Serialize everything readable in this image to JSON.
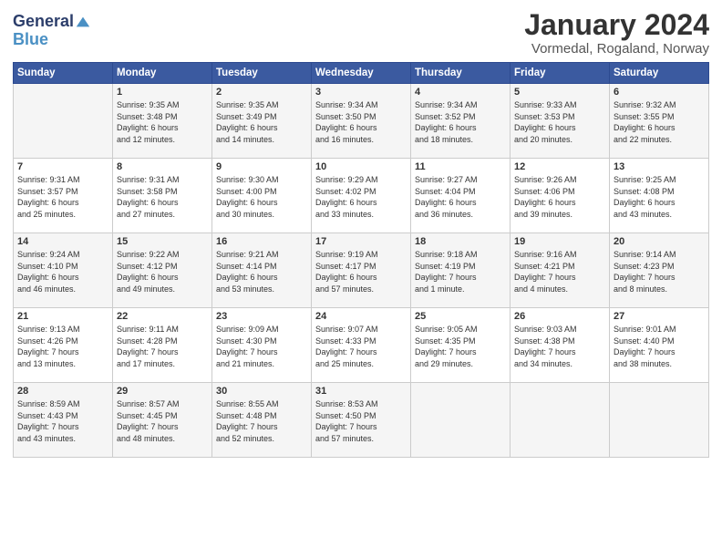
{
  "header": {
    "logo_line1": "General",
    "logo_line2": "Blue",
    "month": "January 2024",
    "location": "Vormedal, Rogaland, Norway"
  },
  "days_of_week": [
    "Sunday",
    "Monday",
    "Tuesday",
    "Wednesday",
    "Thursday",
    "Friday",
    "Saturday"
  ],
  "weeks": [
    [
      {
        "day": "",
        "content": ""
      },
      {
        "day": "1",
        "content": "Sunrise: 9:35 AM\nSunset: 3:48 PM\nDaylight: 6 hours\nand 12 minutes."
      },
      {
        "day": "2",
        "content": "Sunrise: 9:35 AM\nSunset: 3:49 PM\nDaylight: 6 hours\nand 14 minutes."
      },
      {
        "day": "3",
        "content": "Sunrise: 9:34 AM\nSunset: 3:50 PM\nDaylight: 6 hours\nand 16 minutes."
      },
      {
        "day": "4",
        "content": "Sunrise: 9:34 AM\nSunset: 3:52 PM\nDaylight: 6 hours\nand 18 minutes."
      },
      {
        "day": "5",
        "content": "Sunrise: 9:33 AM\nSunset: 3:53 PM\nDaylight: 6 hours\nand 20 minutes."
      },
      {
        "day": "6",
        "content": "Sunrise: 9:32 AM\nSunset: 3:55 PM\nDaylight: 6 hours\nand 22 minutes."
      }
    ],
    [
      {
        "day": "7",
        "content": "Sunrise: 9:31 AM\nSunset: 3:57 PM\nDaylight: 6 hours\nand 25 minutes."
      },
      {
        "day": "8",
        "content": "Sunrise: 9:31 AM\nSunset: 3:58 PM\nDaylight: 6 hours\nand 27 minutes."
      },
      {
        "day": "9",
        "content": "Sunrise: 9:30 AM\nSunset: 4:00 PM\nDaylight: 6 hours\nand 30 minutes."
      },
      {
        "day": "10",
        "content": "Sunrise: 9:29 AM\nSunset: 4:02 PM\nDaylight: 6 hours\nand 33 minutes."
      },
      {
        "day": "11",
        "content": "Sunrise: 9:27 AM\nSunset: 4:04 PM\nDaylight: 6 hours\nand 36 minutes."
      },
      {
        "day": "12",
        "content": "Sunrise: 9:26 AM\nSunset: 4:06 PM\nDaylight: 6 hours\nand 39 minutes."
      },
      {
        "day": "13",
        "content": "Sunrise: 9:25 AM\nSunset: 4:08 PM\nDaylight: 6 hours\nand 43 minutes."
      }
    ],
    [
      {
        "day": "14",
        "content": "Sunrise: 9:24 AM\nSunset: 4:10 PM\nDaylight: 6 hours\nand 46 minutes."
      },
      {
        "day": "15",
        "content": "Sunrise: 9:22 AM\nSunset: 4:12 PM\nDaylight: 6 hours\nand 49 minutes."
      },
      {
        "day": "16",
        "content": "Sunrise: 9:21 AM\nSunset: 4:14 PM\nDaylight: 6 hours\nand 53 minutes."
      },
      {
        "day": "17",
        "content": "Sunrise: 9:19 AM\nSunset: 4:17 PM\nDaylight: 6 hours\nand 57 minutes."
      },
      {
        "day": "18",
        "content": "Sunrise: 9:18 AM\nSunset: 4:19 PM\nDaylight: 7 hours\nand 1 minute."
      },
      {
        "day": "19",
        "content": "Sunrise: 9:16 AM\nSunset: 4:21 PM\nDaylight: 7 hours\nand 4 minutes."
      },
      {
        "day": "20",
        "content": "Sunrise: 9:14 AM\nSunset: 4:23 PM\nDaylight: 7 hours\nand 8 minutes."
      }
    ],
    [
      {
        "day": "21",
        "content": "Sunrise: 9:13 AM\nSunset: 4:26 PM\nDaylight: 7 hours\nand 13 minutes."
      },
      {
        "day": "22",
        "content": "Sunrise: 9:11 AM\nSunset: 4:28 PM\nDaylight: 7 hours\nand 17 minutes."
      },
      {
        "day": "23",
        "content": "Sunrise: 9:09 AM\nSunset: 4:30 PM\nDaylight: 7 hours\nand 21 minutes."
      },
      {
        "day": "24",
        "content": "Sunrise: 9:07 AM\nSunset: 4:33 PM\nDaylight: 7 hours\nand 25 minutes."
      },
      {
        "day": "25",
        "content": "Sunrise: 9:05 AM\nSunset: 4:35 PM\nDaylight: 7 hours\nand 29 minutes."
      },
      {
        "day": "26",
        "content": "Sunrise: 9:03 AM\nSunset: 4:38 PM\nDaylight: 7 hours\nand 34 minutes."
      },
      {
        "day": "27",
        "content": "Sunrise: 9:01 AM\nSunset: 4:40 PM\nDaylight: 7 hours\nand 38 minutes."
      }
    ],
    [
      {
        "day": "28",
        "content": "Sunrise: 8:59 AM\nSunset: 4:43 PM\nDaylight: 7 hours\nand 43 minutes."
      },
      {
        "day": "29",
        "content": "Sunrise: 8:57 AM\nSunset: 4:45 PM\nDaylight: 7 hours\nand 48 minutes."
      },
      {
        "day": "30",
        "content": "Sunrise: 8:55 AM\nSunset: 4:48 PM\nDaylight: 7 hours\nand 52 minutes."
      },
      {
        "day": "31",
        "content": "Sunrise: 8:53 AM\nSunset: 4:50 PM\nDaylight: 7 hours\nand 57 minutes."
      },
      {
        "day": "",
        "content": ""
      },
      {
        "day": "",
        "content": ""
      },
      {
        "day": "",
        "content": ""
      }
    ]
  ]
}
